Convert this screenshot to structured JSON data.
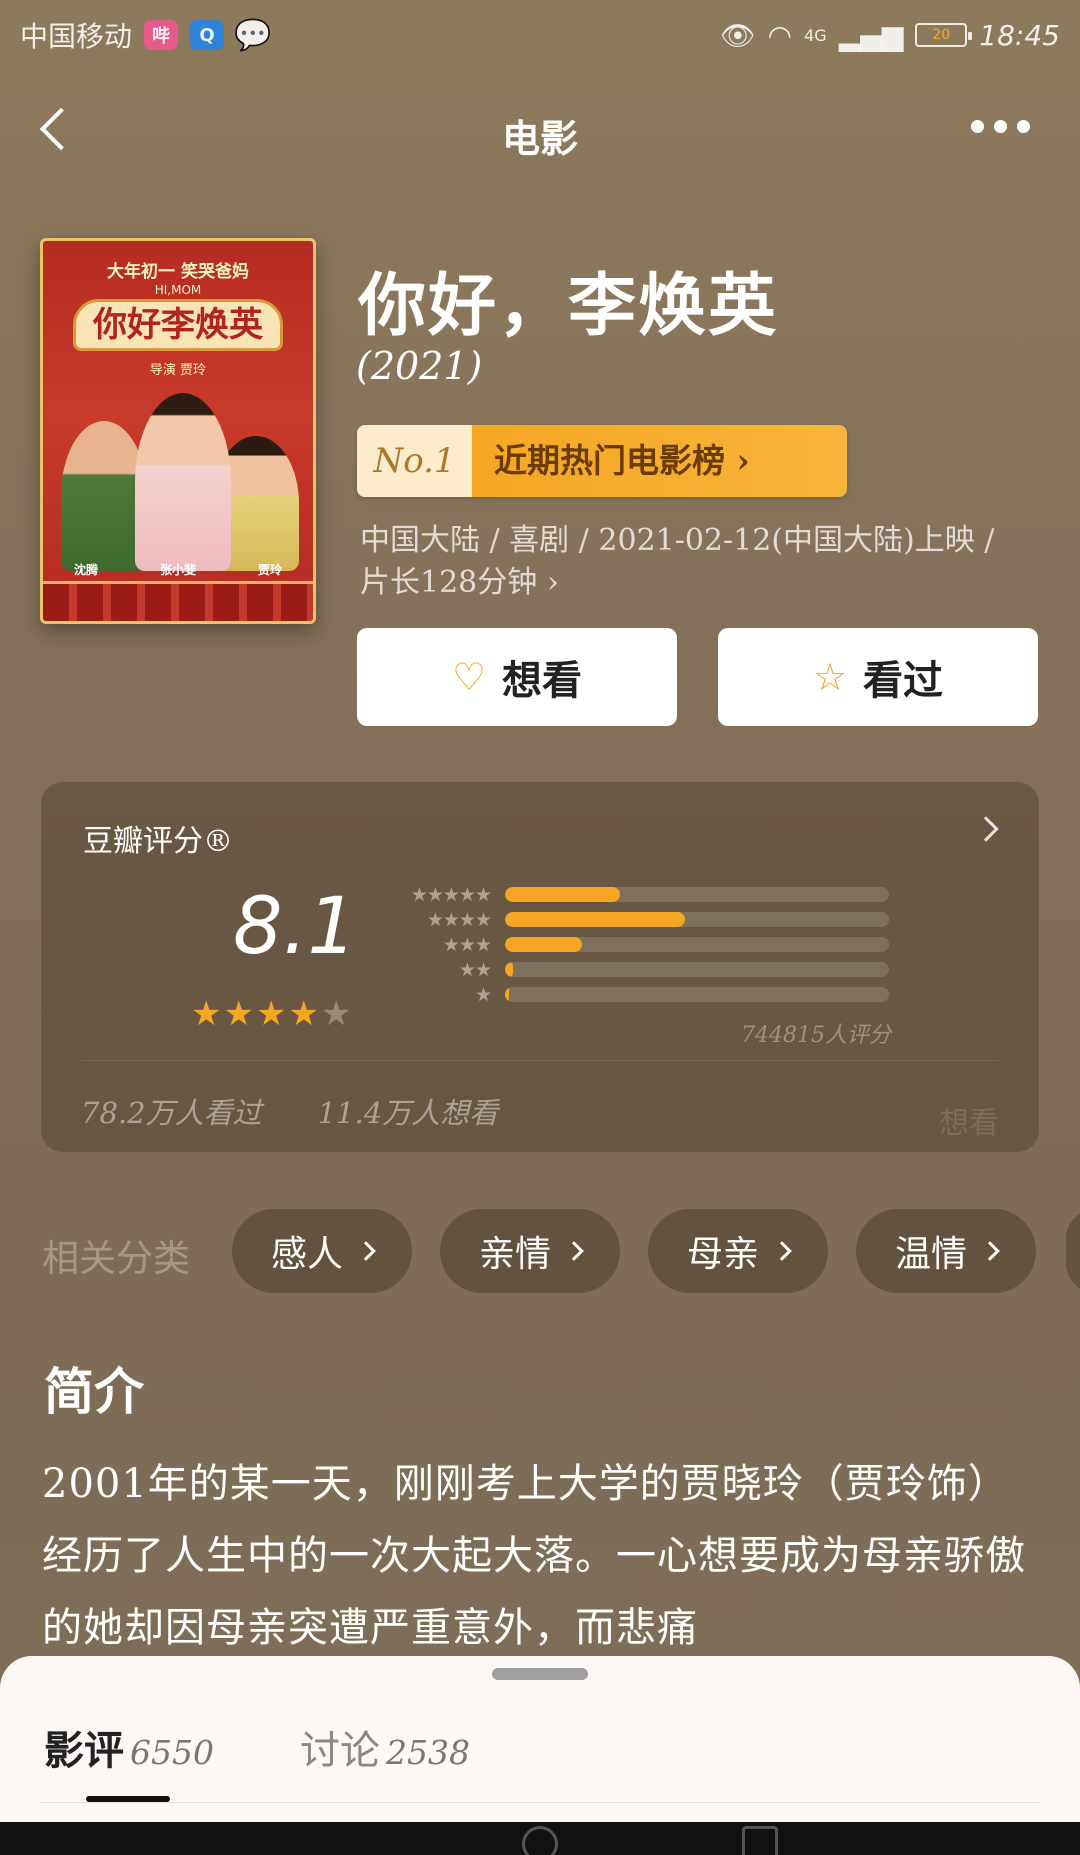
{
  "statusbar": {
    "carrier": "中国移动",
    "apps": [
      {
        "name": "bilibili-icon",
        "glyph": "哔"
      },
      {
        "name": "qq-browser-icon",
        "glyph": "Q"
      },
      {
        "name": "chat-bubble-icon",
        "glyph": "💬"
      }
    ],
    "network": "4G",
    "battery": "20",
    "time": "18:45"
  },
  "navbar": {
    "title": "电影"
  },
  "poster": {
    "tagline": "大年初一 笑哭爸妈",
    "english_title": "HI,MOM",
    "title": "你好李焕英",
    "director_line": "导演 贾玲",
    "cast": [
      "沈腾",
      "张小斐",
      "贾玲"
    ]
  },
  "movie": {
    "title": "你好，李焕英",
    "year": "(2021)",
    "rank_no": "No.1",
    "rank_name": "近期热门电影榜",
    "meta_line1": "中国大陆 / 喜剧 / 2021-02-12(中国大陆)上映 /",
    "meta_line2": "片长128分钟"
  },
  "actions": {
    "want_label": "想看",
    "want_icon": "heart-plus-icon",
    "seen_label": "看过",
    "seen_icon": "star-outline-icon"
  },
  "rating": {
    "header": "豆瓣评分®",
    "score": "8.1",
    "stars": 4,
    "distribution": [
      {
        "stars": "★★★★★",
        "fraction": 0.3
      },
      {
        "stars": "★★★★",
        "fraction": 0.47
      },
      {
        "stars": "★★★",
        "fraction": 0.2
      },
      {
        "stars": "★★",
        "fraction": 0.02
      },
      {
        "stars": "★",
        "fraction": 0.004
      }
    ],
    "count": "744815人评分",
    "watched": "78.2万人看过",
    "wants": "11.4万人想看",
    "watermark": "想看"
  },
  "tags": {
    "label": "相关分类",
    "items": [
      "感人",
      "亲情",
      "母亲",
      "温情"
    ]
  },
  "intro": {
    "title": "简介",
    "text": "2001年的某一天，刚刚考上大学的贾晓玲（贾玲饰）经历了人生中的一次大起大落。一心想要成为母亲骄傲的她却因母亲突遭严重意外，而悲痛"
  },
  "sheet": {
    "tabs": [
      {
        "label": "影评",
        "count": "6550"
      },
      {
        "label": "讨论",
        "count": "2538"
      }
    ]
  },
  "colors": {
    "accent": "#f5a623",
    "background": "#85715a"
  }
}
